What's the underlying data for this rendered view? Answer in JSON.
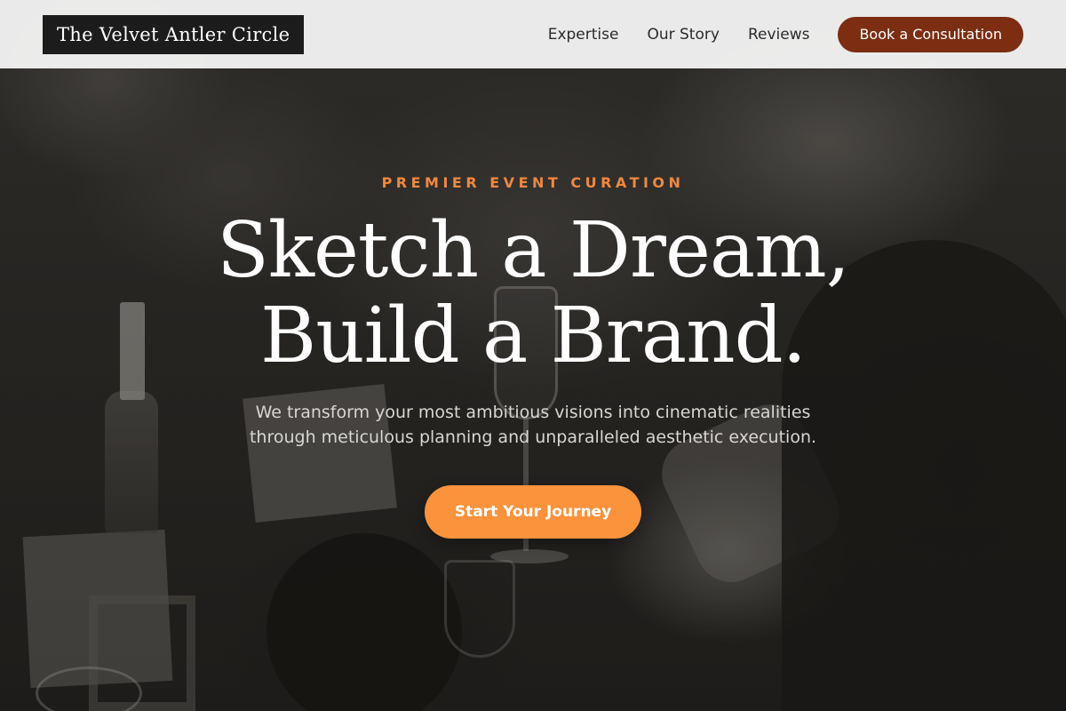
{
  "nav": {
    "logo": "The Velvet Antler Circle",
    "links": [
      "Expertise",
      "Our Story",
      "Reviews"
    ],
    "cta": "Book a Consultation"
  },
  "hero": {
    "eyebrow": "PREMIER EVENT CURATION",
    "headline_lines": [
      "Sketch a Dream,",
      "Build a Brand."
    ],
    "subtext_lines": [
      "We transform your most ambitious visions into cinematic realities",
      "through meticulous planning and unparalleled aesthetic execution."
    ],
    "cta": "Start Your Journey"
  },
  "colors": {
    "accent": "#fb923c",
    "eyebrow": "#f0883e",
    "nav_cta": "#7c2d12",
    "logo_bg": "#1c1c1c"
  }
}
